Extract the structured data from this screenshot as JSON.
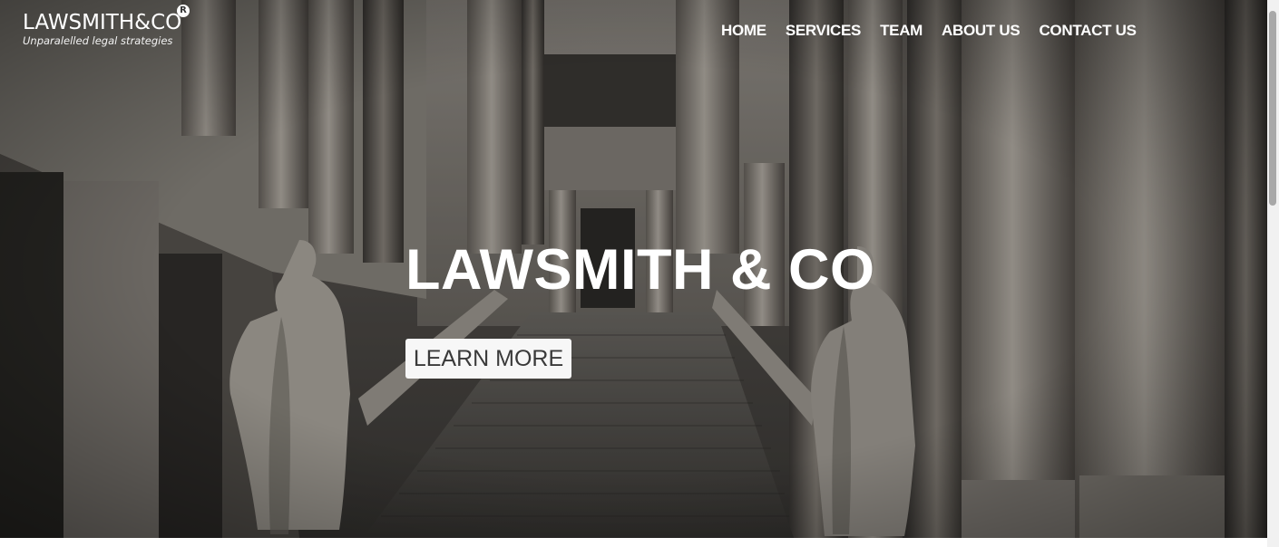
{
  "brand": {
    "name": "LAWSMITH&CO",
    "registered_mark": "R",
    "tagline": "Unparalelled legal strategies"
  },
  "nav": {
    "items": [
      {
        "label": "HOME"
      },
      {
        "label": "SERVICES"
      },
      {
        "label": "TEAM"
      },
      {
        "label": "ABOUT US"
      },
      {
        "label": "CONTACT US"
      }
    ]
  },
  "hero": {
    "title": "LAWSMITH & CO",
    "cta_label": "LEARN MORE",
    "background_image": "courthouse-colonnade-with-statues-and-staircase"
  },
  "colors": {
    "text_light": "#ffffff",
    "button_bg": "#f7f7f7",
    "button_text": "#3a3a3a"
  }
}
